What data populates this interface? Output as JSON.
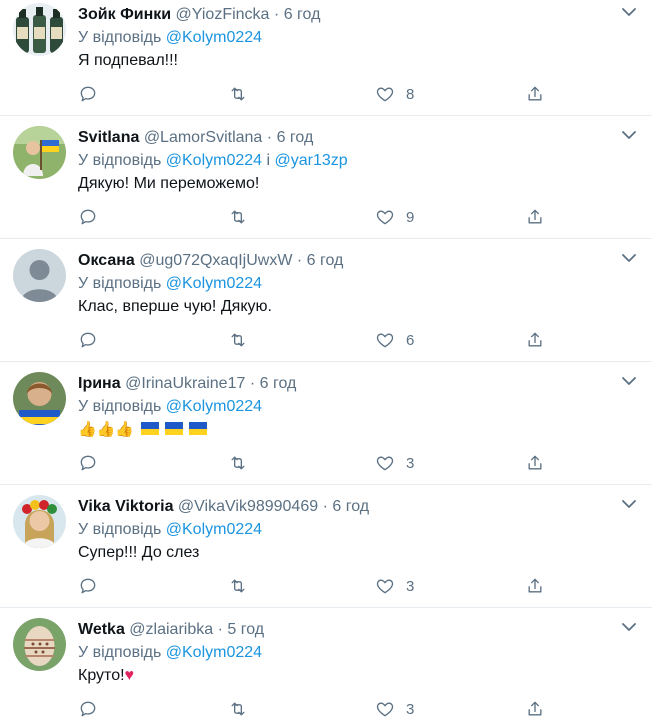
{
  "reply_prefix": "У відповідь",
  "tweets": [
    {
      "name": "Зойк Финки",
      "handle": "@YiozFincka",
      "time": "6 год",
      "reply_to": "@Kolym0224",
      "text": "Я подпевал!!!",
      "likes": "8",
      "avatar": "bottles"
    },
    {
      "name": "Svitlana",
      "handle": "@LamorSvitlana",
      "time": "6 год",
      "reply_to": "@Kolym0224",
      "reply_conj": "і",
      "reply_to2": "@yar13zp",
      "text": "Дякую! Ми переможемо!",
      "likes": "9",
      "avatar": "outdoor-flag"
    },
    {
      "name": "Оксана",
      "handle": "@ug072QxaqIjUwxW",
      "time": "6 год",
      "reply_to": "@Kolym0224",
      "text": "Клас, вперше чую! Дякую.",
      "likes": "6",
      "avatar": "default-person"
    },
    {
      "name": "Ірина",
      "handle": "@IrinaUkraine17",
      "time": "6 год",
      "reply_to": "@Kolym0224",
      "text": "",
      "likes": "3",
      "emojis": [
        "👍",
        "👍",
        "👍",
        "flag-ua",
        "flag-ua",
        "flag-ua"
      ],
      "avatar": "woman-portrait"
    },
    {
      "name": "Vika Viktoria",
      "handle": "@VikaVik98990469",
      "time": "6 год",
      "reply_to": "@Kolym0224",
      "text": "Супер!!! До слез",
      "likes": "3",
      "avatar": "flower-wreath"
    },
    {
      "name": "Wetka",
      "handle": "@zlaiaribka",
      "time": "5 год",
      "reply_to": "@Kolym0224",
      "text": "Круто!",
      "text_emoji": "♥",
      "likes": "3",
      "avatar": "painted-egg"
    }
  ],
  "colors": {
    "text": "#0f1419",
    "secondary": "#5b7083",
    "link": "#1b95e0",
    "divider": "#e6ecf0",
    "flag_blue": "#1f5ac8",
    "flag_yellow": "#ffd21f",
    "heart": "#e0245e"
  },
  "icons": [
    "reply-icon",
    "retweet-icon",
    "like-icon",
    "share-icon",
    "chevron-down-icon"
  ]
}
